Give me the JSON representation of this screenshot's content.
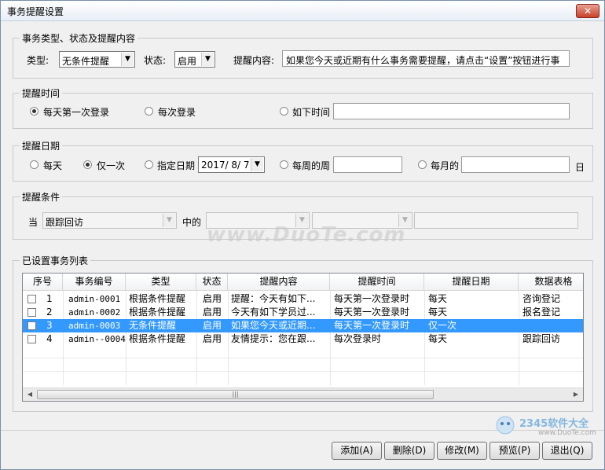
{
  "window": {
    "title": "事务提醒设置",
    "close": "✕"
  },
  "type_section": {
    "title": "事务类型、状态及提醒内容",
    "type_label": "类型:",
    "type_value": "无条件提醒",
    "status_label": "状态:",
    "status_value": "启用",
    "content_label": "提醒内容:",
    "content_value": "如果您今天或近期有什么事务需要提醒，请点击“设置”按钮进行事"
  },
  "time_section": {
    "title": "提醒时间",
    "opt1": "每天第一次登录",
    "opt2": "每次登录",
    "opt3": "如下时间"
  },
  "date_section": {
    "title": "提醒日期",
    "opt1": "每天",
    "opt2": "仅一次",
    "opt3": "指定日期",
    "date_value": "2017/ 8/ 7",
    "opt4": "每周的周",
    "opt5": "每月的",
    "suffix": "日"
  },
  "cond_section": {
    "title": "提醒条件",
    "when_label": "当",
    "field_value": "跟踪回访",
    "in_label": "中的"
  },
  "list_section": {
    "title": "已设置事务列表",
    "columns": [
      "序号",
      "事务编号",
      "类型",
      "状态",
      "提醒内容",
      "提醒时间",
      "提醒日期",
      "数据表格"
    ],
    "rows": [
      [
        "1",
        "admin-0001",
        "根据条件提醒",
        "启用",
        "提醒：今天有如下...",
        "每天第一次登录时",
        "每天",
        "咨询登记"
      ],
      [
        "2",
        "admin-0002",
        "根据条件提醒",
        "启用",
        "今天有如下学员过...",
        "每天第一次登录时",
        "每天",
        "报名登记"
      ],
      [
        "3",
        "admin-0003",
        "无条件提醒",
        "启用",
        "如果您今天或近期...",
        "每天第一次登录时",
        "仅一次",
        ""
      ],
      [
        "4",
        "admin--0004",
        "根据条件提醒",
        "启用",
        "友情提示：您在跟...",
        "每次登录时",
        "每天",
        "跟踪回访"
      ]
    ],
    "selected_row": 2
  },
  "buttons": {
    "add": "添加(A)",
    "delete": "删除(D)",
    "modify": "修改(M)",
    "preview": "预览(P)",
    "exit": "退出(Q)"
  },
  "watermark": "www.DuoTe.com",
  "logo": {
    "text": "2345软件大全",
    "url": "www.DuoTe.com"
  }
}
